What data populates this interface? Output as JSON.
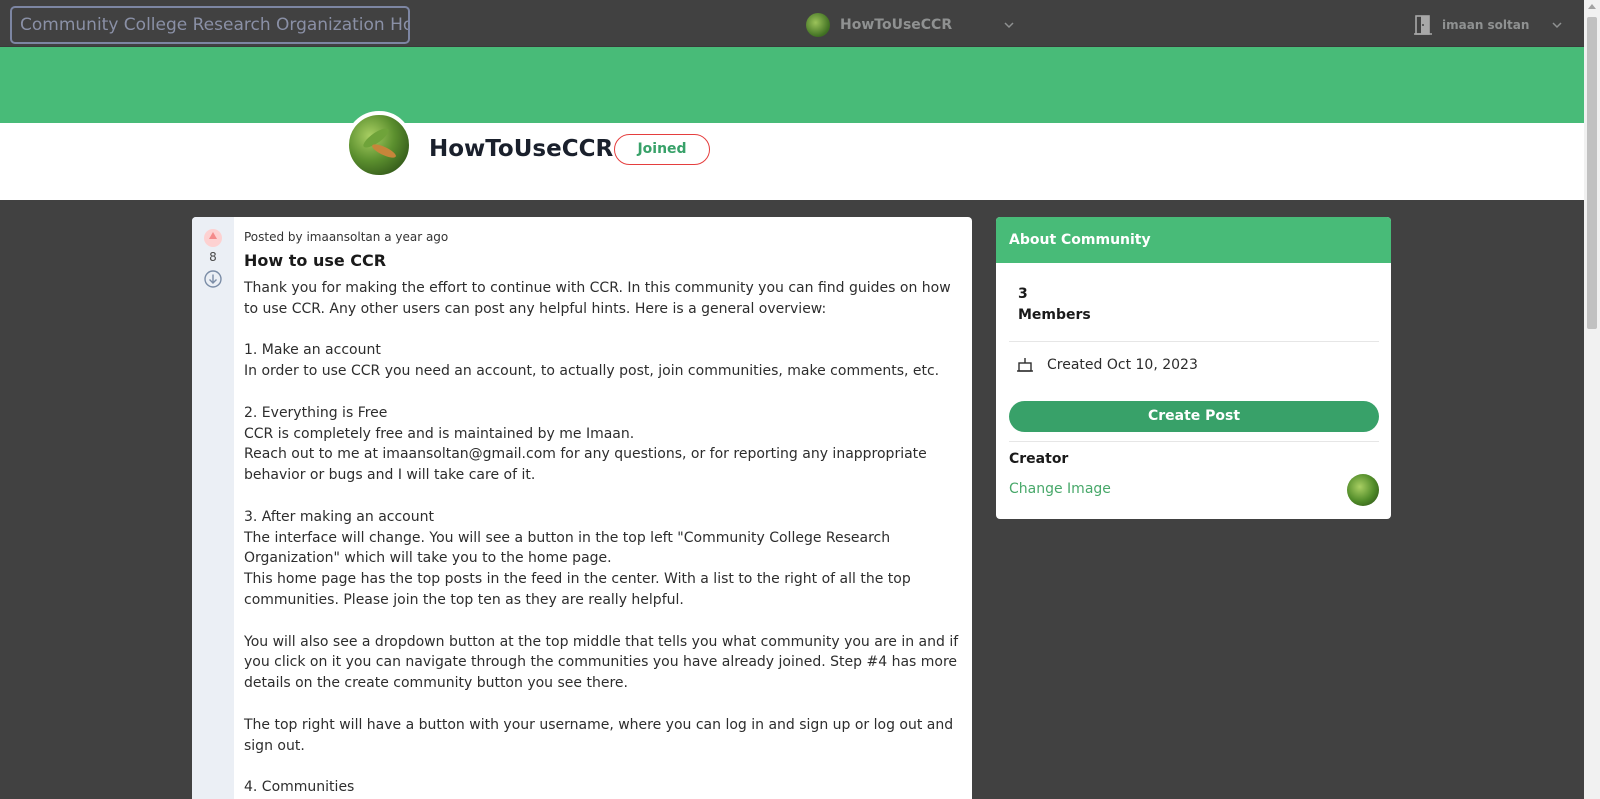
{
  "topbar": {
    "home_label": "Community College Research Organization Home",
    "community_name": "HowToUseCCR",
    "username": "imaan soltan"
  },
  "community": {
    "title": "HowToUseCCR",
    "joined_label": "Joined"
  },
  "post": {
    "vote_count": "8",
    "meta": "Posted by imaansoltan a year ago",
    "title": "How to use CCR",
    "body": "Thank you for making the effort to continue with CCR. In this community you can find guides on how to use CCR. Any other users can post any helpful hints. Here is a general overview:\n\n1. Make an account\nIn order to use CCR you need an account, to actually post, join communities, make comments, etc.\n\n2. Everything is Free\nCCR is completely free and is maintained by me Imaan.\nReach out to me at imaansoltan@gmail.com for any questions, or for reporting any inappropriate behavior or bugs and I will take care of it.\n\n3. After making an account\nThe interface will change. You will see a button in the top left \"Community College Research Organization\" which will take you to the home page.\nThis home page has the top posts in the feed in the center. With a list to the right of all the top communities. Please join the top ten as they are really helpful.\n\nYou will also see a dropdown button at the top middle that tells you what community you are in and if you click on it you can navigate through the communities you have already joined. Step #4 has more details on the create community button you see there.\n\nThe top right will have a button with your username, where you can log in and sign up or log out and sign out.\n\n4. Communities"
  },
  "about": {
    "header": "About Community",
    "member_count": "3",
    "members_label": "Members",
    "created": "Created Oct 10, 2023",
    "create_post_label": "Create Post",
    "creator_label": "Creator",
    "change_image_label": "Change Image"
  },
  "colors": {
    "accent_green": "#48bb78",
    "button_green": "#38a169",
    "background": "#414141",
    "joined_border": "#e53e3e"
  },
  "icons": [
    "community-avatar-icon",
    "chevron-down-icon",
    "door-icon",
    "upvote-icon",
    "downvote-icon",
    "cake-icon",
    "creator-avatar-icon"
  ]
}
